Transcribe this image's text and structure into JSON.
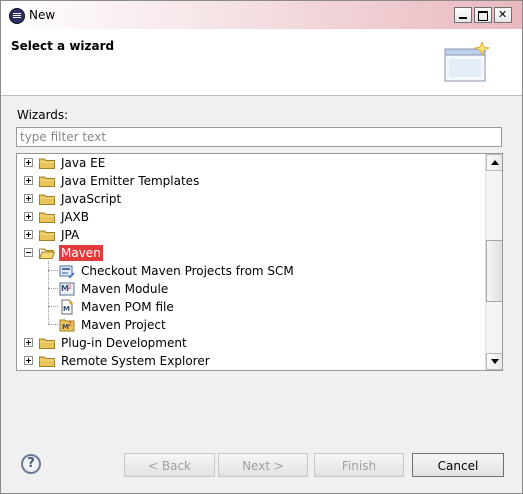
{
  "window": {
    "title": "New"
  },
  "header": {
    "title": "Select a wizard"
  },
  "wizards_label": "Wizards:",
  "filter": {
    "placeholder": "type filter text",
    "value": ""
  },
  "tree": {
    "items": [
      {
        "label": "Java EE",
        "expanded": false,
        "level": 0
      },
      {
        "label": "Java Emitter Templates",
        "expanded": false,
        "level": 0
      },
      {
        "label": "JavaScript",
        "expanded": false,
        "level": 0
      },
      {
        "label": "JAXB",
        "expanded": false,
        "level": 0
      },
      {
        "label": "JPA",
        "expanded": false,
        "level": 0
      },
      {
        "label": "Maven",
        "expanded": true,
        "level": 0,
        "selected": true
      },
      {
        "label": "Checkout Maven Projects from SCM",
        "level": 1
      },
      {
        "label": "Maven Module",
        "level": 1
      },
      {
        "label": "Maven POM file",
        "level": 1
      },
      {
        "label": "Maven Project",
        "level": 1
      },
      {
        "label": "Plug-in Development",
        "expanded": false,
        "level": 0
      },
      {
        "label": "Remote System Explorer",
        "expanded": false,
        "level": 0
      }
    ]
  },
  "buttons": {
    "back": "< Back",
    "next": "Next >",
    "finish": "Finish",
    "cancel": "Cancel"
  },
  "help_glyph": "?",
  "colors": {
    "selection": "#e33b3b",
    "folder": "#e8c45a"
  }
}
